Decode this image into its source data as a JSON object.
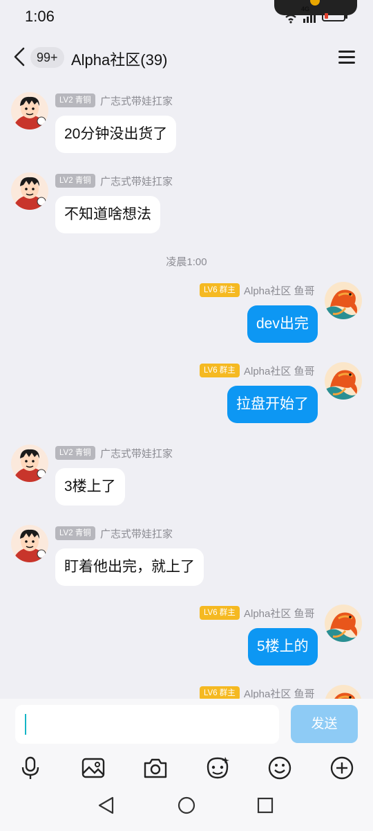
{
  "status_bar": {
    "time": "1:06",
    "network": "4G"
  },
  "header": {
    "unread_badge": "99+",
    "title": "Alpha社区(39)"
  },
  "messages": [
    {
      "side": "in",
      "level": "LV2 青铜",
      "nick": "广志式带娃扛家",
      "text": "20分钟没出货了"
    },
    {
      "side": "in",
      "level": "LV2 青铜",
      "nick": "广志式带娃扛家",
      "text": "不知道啥想法"
    },
    {
      "side": "out",
      "level": "LV6 群主",
      "nick": "Alpha社区 鱼哥",
      "text": "dev出完"
    },
    {
      "side": "out",
      "level": "LV6 群主",
      "nick": "Alpha社区 鱼哥",
      "text": "拉盘开始了"
    },
    {
      "side": "in",
      "level": "LV2 青铜",
      "nick": "广志式带娃扛家",
      "text": "3楼上了"
    },
    {
      "side": "in",
      "level": "LV2 青铜",
      "nick": "广志式带娃扛家",
      "text": "盯着他出完，就上了"
    },
    {
      "side": "out",
      "level": "LV6 群主",
      "nick": "Alpha社区 鱼哥",
      "text": "5楼上的"
    },
    {
      "side": "out",
      "level": "LV6 群主",
      "nick": "Alpha社区 鱼哥",
      "text": ""
    }
  ],
  "timestamp": "凌晨1:00",
  "input": {
    "value": "",
    "send_label": "发送"
  },
  "toolbar_icons": [
    "microphone-icon",
    "image-icon",
    "camera-icon",
    "sticker-icon",
    "emoji-icon",
    "plus-icon"
  ],
  "nav_icons": [
    "back-triangle-icon",
    "home-circle-icon",
    "recents-square-icon"
  ],
  "colors": {
    "out_bubble": "#0d97f3",
    "in_bubble": "#ffffff",
    "badge_owner": "#f5b921",
    "badge_member": "#b7b7bd",
    "send_button_disabled": "#8ecbf5"
  }
}
